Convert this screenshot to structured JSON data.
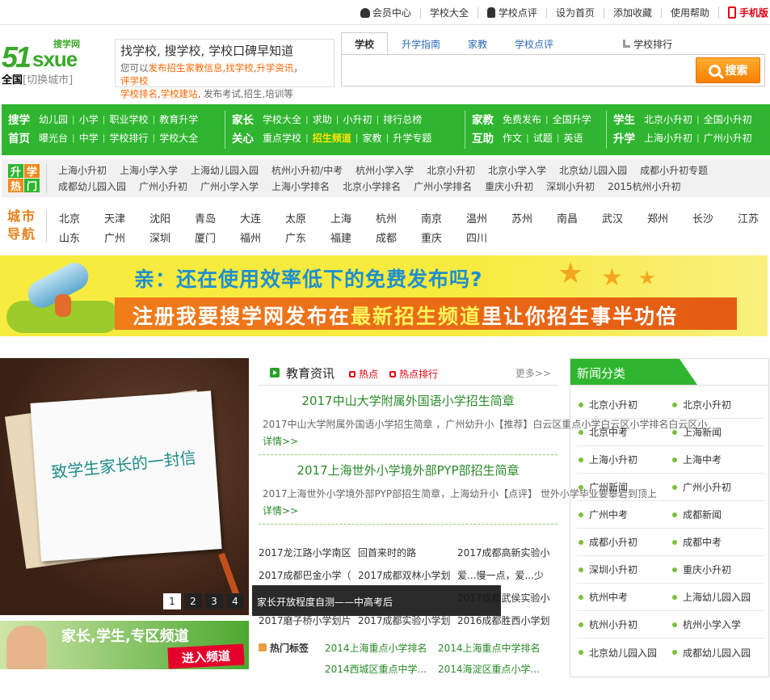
{
  "topbar": {
    "links": [
      "会员中心",
      "学校大全",
      "学校点评",
      "设为首页",
      "添加收藏",
      "使用帮助"
    ],
    "mobile": "手机版"
  },
  "logo": {
    "num": "51",
    "word": "sxue",
    "cn": "搜学网"
  },
  "city": {
    "name": "全国",
    "switch": "[切换城市]"
  },
  "slogan": {
    "title": "找学校, 搜学校, 学校口碑早知道",
    "desc_prefix": "您可以",
    "desc_links": [
      "发布招生家教信息",
      "找学校",
      "升学资讯",
      "评学校",
      "学校排名",
      "学校建站"
    ],
    "desc_suffix": ", 发布考试,招生,培训等"
  },
  "search": {
    "tabs": [
      "学校",
      "升学指南",
      "家教",
      "学校点评"
    ],
    "rank": "学校排行",
    "placeholder": "",
    "button": "搜索"
  },
  "green_nav": {
    "sections": [
      {
        "labels": [
          "搜学",
          "首页"
        ],
        "rows": [
          [
            "幼儿园",
            "小学",
            "职业学校",
            "教育升学"
          ],
          [
            "曝光台",
            "中学",
            "学校排行",
            "学校大全"
          ]
        ]
      },
      {
        "labels": [
          "家长",
          "关心"
        ],
        "rows": [
          [
            "学校大全",
            "求助",
            "小升初",
            "排行总榜"
          ],
          [
            "重点学校",
            "招生频道",
            "家教",
            "升学专题"
          ]
        ]
      },
      {
        "labels": [
          "家教",
          "互助"
        ],
        "rows": [
          [
            "免费发布",
            "全国升学"
          ],
          [
            "作文",
            "试题",
            "英语"
          ]
        ]
      },
      {
        "labels": [
          "学生",
          "升学"
        ],
        "rows": [
          [
            "北京小升初",
            "全国小升初"
          ],
          [
            "上海小升初",
            "广州小升初"
          ]
        ]
      }
    ],
    "highlight": "招生频道"
  },
  "hot": {
    "badge": [
      "升",
      "学",
      "热",
      "门"
    ],
    "rows": [
      [
        "上海小升初",
        "上海小学入学",
        "上海幼儿园入园",
        "杭州小升初/中考",
        "杭州小学入学",
        "北京小升初",
        "北京小学入学",
        "北京幼儿园入园",
        "成都小升初专题"
      ],
      [
        "成都幼儿园入园",
        "广州小升初",
        "广州小学入学",
        "上海小学排名",
        "北京小学排名",
        "广州小学排名",
        "重庆小升初",
        "深圳小升初",
        "2015杭州小升初"
      ]
    ]
  },
  "city_nav": {
    "label": [
      "城市",
      "导航"
    ],
    "rows": [
      [
        "北京",
        "天津",
        "沈阳",
        "青岛",
        "大连",
        "太原",
        "上海",
        "杭州",
        "南京",
        "温州",
        "苏州",
        "南昌",
        "武汉",
        "郑州",
        "长沙",
        "江苏",
        "浙江"
      ],
      [
        "山东",
        "广州",
        "深圳",
        "厦门",
        "福州",
        "广东",
        "福建",
        "成都",
        "重庆",
        "四川"
      ]
    ]
  },
  "banner": {
    "line1": "亲：还在使用效率低下的免费发布吗?",
    "line2_a": "注册我要搜学网发布在",
    "line2_b": "最新招生频道",
    "line2_c": "里让你招生事半功倍"
  },
  "slideshow": {
    "paper_text": "致学生家长的一封信",
    "pages": [
      "1",
      "2",
      "3",
      "4"
    ],
    "active_page": "1",
    "caption": "家长开放程度自测——中高考后"
  },
  "zone": {
    "title": "家长,学生,专区频道",
    "button": "进入频道"
  },
  "news": {
    "title": "教育资讯",
    "tags": [
      "热点",
      "热点排行"
    ],
    "more": "更多>>",
    "articles": [
      {
        "title": "2017中山大学附属外国语小学招生简章",
        "summary": "2017中山大学附属外国语小学招生简章 ，广州幼升小【推荐】白云区重点小学白云区小学排名白云区小",
        "more": "详情>>"
      },
      {
        "title": "2017上海世外小学境外部PYP部招生简章",
        "summary": "2017上海世外小学境外部PYP部招生简章，上海幼升小【点评】 世外小学毕业要攀岩到顶上",
        "more": "详情>>"
      }
    ],
    "list": [
      [
        "2017龙江路小学南区",
        "回首来时的路",
        "2017成都高新实验小"
      ],
      [
        "2017成都巴金小学（",
        "2017成都双林小学划",
        "爱...慢一点，爱...少"
      ],
      [
        "",
        "",
        "2017成都武侯实验小"
      ],
      [
        "2017磨子桥小学划片",
        "2017成都实验小学划",
        "2016成都胜西小学划"
      ]
    ],
    "hot_tags_label": "热门标签",
    "hot_tags": [
      "2014上海重点小学排名",
      "2014上海重点中学排名",
      "2014西城区重点中学...",
      "2014海淀区重点小学..."
    ]
  },
  "categories": {
    "title": "新闻分类",
    "items": [
      [
        "北京小升初",
        "北京小升初"
      ],
      [
        "北京中考",
        "上海新闻"
      ],
      [
        "上海小升初",
        "上海中考"
      ],
      [
        "广州新闻",
        "广州小升初"
      ],
      [
        "广州中考",
        "成都新闻"
      ],
      [
        "成都小升初",
        "成都中考"
      ],
      [
        "深圳小升初",
        "重庆小升初"
      ],
      [
        "杭州中考",
        "上海幼儿园入园"
      ],
      [
        "杭州小升初",
        "杭州小学入学"
      ],
      [
        "北京幼儿园入园",
        "成都幼儿园入园"
      ]
    ]
  },
  "colors": {
    "brand_green": "#2fb52f",
    "accent_orange": "#f77f00",
    "link_blue": "#2a6ab8",
    "hot_red": "#e60012"
  }
}
